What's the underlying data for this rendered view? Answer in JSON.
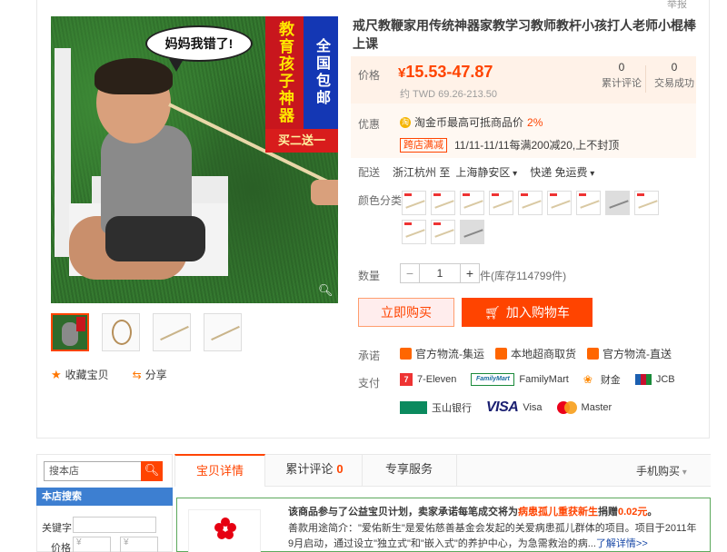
{
  "report_link": "举报",
  "main_image": {
    "speech_bubble": "妈妈我错了!",
    "banner_red": "教育孩子神器",
    "banner_blue": "全国包邮",
    "banner_bar": "买二送一"
  },
  "actions": {
    "favorite": "收藏宝贝",
    "share": "分享"
  },
  "product": {
    "title": "戒尺教鞭家用传统神器家教学习教师教杆小孩打人老师小棍棒上课",
    "price_label": "价格",
    "price": "15.53-47.87",
    "currency_symbol": "¥",
    "price_twd": "约 TWD 69.26-213.50",
    "reviews_count": "0",
    "reviews_label": "累计评论",
    "sales_count": "0",
    "sales_label": "交易成功"
  },
  "promotion": {
    "label": "优惠",
    "coin_text": "淘金币最高可抵商品价",
    "coin_percent": "2%",
    "tag": "跨店满减",
    "tag_text": "11/11-11/11每满200减20,上不封顶"
  },
  "delivery": {
    "label": "配送",
    "from": "浙江杭州 至",
    "to": "上海静安区",
    "method": "快递 免运费"
  },
  "color_label": "颜色分类",
  "quantity": {
    "label": "数量",
    "minus": "−",
    "value": "1",
    "plus": "+",
    "stock": "件(库存114799件)"
  },
  "buttons": {
    "buy_now": "立即购买",
    "add_cart": "加入购物车"
  },
  "promise": {
    "label": "承诺",
    "items": [
      "官方物流-集运",
      "本地超商取货",
      "官方物流-直送"
    ]
  },
  "payment": {
    "label": "支付",
    "seven": "7-Eleven",
    "familymart_logo": "FamilyMart",
    "familymart": "FamilyMart",
    "caifu": "财金",
    "jcb": "JCB",
    "yushan": "玉山银行",
    "visa_logo": "VISA",
    "visa": "Visa",
    "master": "Master"
  },
  "sidebar": {
    "search_placeholder": "搜本店",
    "store_search_title": "本店搜索",
    "keyword_label": "关键字",
    "price_label": "价格",
    "price_currency": "¥"
  },
  "tabs": {
    "details": "宝贝详情",
    "reviews": "累计评论",
    "reviews_count": "0",
    "service": "专享服务",
    "mobile_buy": "手机购买"
  },
  "charity": {
    "line1_prefix": "该商品参与了公益宝贝计划，卖家承诺每笔成交将为",
    "line1_project": "病患孤儿重获新生",
    "line1_mid": "捐赠",
    "line1_amount": "0.02元",
    "line1_suffix": "。",
    "line2": "善款用途简介：\"爱佑新生\"是爱佑慈善基金会发起的关爱病患孤儿群体的项目。项目于2011年9月启动，通过设立\"独立式\"和\"嵌入式\"的养护中心，为急需救治的病...",
    "more": "了解详情>>"
  }
}
